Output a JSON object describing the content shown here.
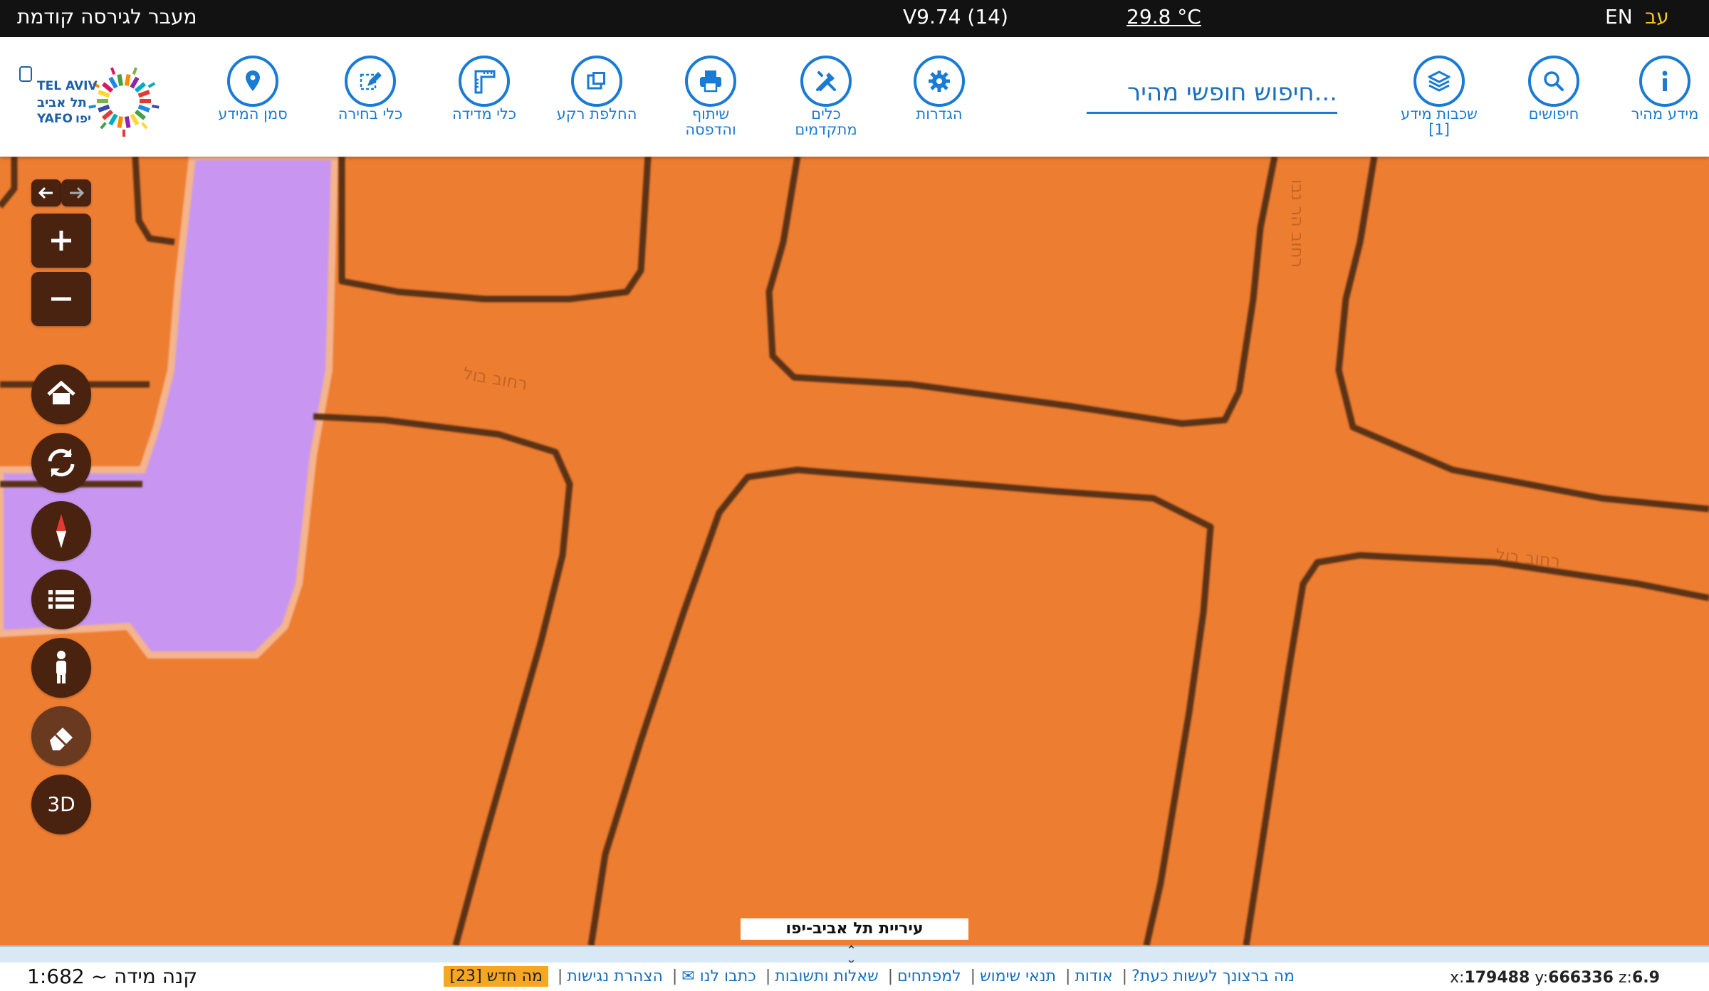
{
  "topbar": {
    "prev_version": "מעבר לגירסה קודמת",
    "version": "V9.74 (14)",
    "temperature": "29.8 °C",
    "lang_en": "EN",
    "lang_he": "עב"
  },
  "toolbar": {
    "quick_info": "מידע מהיר",
    "searches": "חיפושים",
    "layers": "שכבות מידע",
    "layers_count": "[1]",
    "search_placeholder": "...חיפוש חופשי מהיר",
    "settings": "הגדרות",
    "advanced_tools": "כלים",
    "advanced_tools_2": "מתקדמים",
    "share_print": "שיתוף",
    "share_print_2": "והדפסה",
    "switch_background": "החלפת רקע",
    "measure_tools": "כלי מדידה",
    "select_tools": "כלי בחירה",
    "info_marker": "סמן המידע"
  },
  "logo": {
    "text_tel_aviv": "TEL AVIV",
    "text_yafo": "YAFO",
    "text_he_tel_aviv": "תל אביב",
    "text_he_yafo": "יפו"
  },
  "map": {
    "street_label_1": "רחוב בול",
    "street_label_2": "רחוב בול",
    "street_label_3": "רחוב הר נבו",
    "caption": "עיריית תל אביב-יפו",
    "control_3d": "3D"
  },
  "bottom": {
    "scale_label": "קנה מידה ~ 1:682",
    "link_what_now": "מה ברצונך לעשות כעת?",
    "link_about": "אודות",
    "link_terms": "תנאי שימוש",
    "link_developers": "למפתחים",
    "link_faq": "שאלות ותשובות",
    "link_contact": "כתבו לנו ✉",
    "link_accessibility": "הצהרת נגישות",
    "link_whats_new": "מה חדש [23]",
    "coord_x_label": "x:",
    "coord_x": "179488",
    "coord_y_label": "y:",
    "coord_y": "666336",
    "coord_z_label": "z:",
    "coord_z": "6.9"
  },
  "colors": {
    "map_fill": "#ed7d31",
    "road_line": "#5a3012",
    "park": "#c896f0",
    "accent": "#1a7bd4",
    "control_bg": "#4a2210"
  }
}
